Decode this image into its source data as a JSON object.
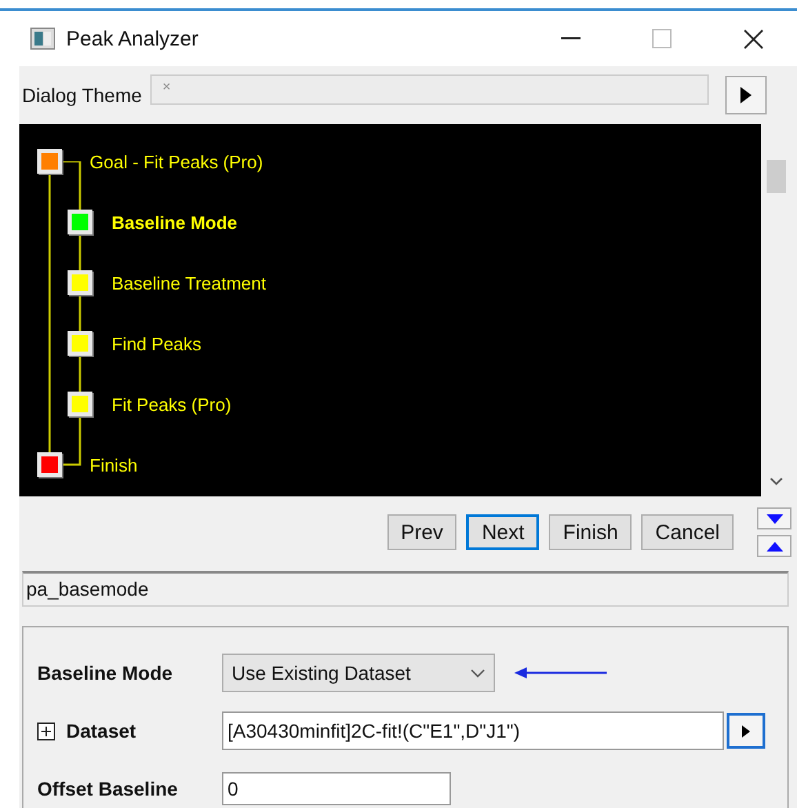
{
  "window": {
    "title": "Peak Analyzer"
  },
  "dialog_theme": {
    "label": "Dialog Theme",
    "value": "×"
  },
  "tree": [
    {
      "label": "Goal - Fit Peaks (Pro)",
      "color": "#ff7f00",
      "selected": false,
      "children": [
        {
          "label": "Baseline Mode",
          "color": "#00ff00",
          "selected": true
        },
        {
          "label": "Baseline Treatment",
          "color": "#ffff00",
          "selected": false
        },
        {
          "label": "Find Peaks",
          "color": "#ffff00",
          "selected": false
        },
        {
          "label": "Fit Peaks (Pro)",
          "color": "#ffff00",
          "selected": false
        }
      ]
    },
    {
      "label": "Finish",
      "color": "#ff0000",
      "selected": false
    }
  ],
  "buttons": [
    {
      "label": "Prev",
      "selected": false
    },
    {
      "label": "Next",
      "selected": true
    },
    {
      "label": "Finish",
      "selected": false
    },
    {
      "label": "Cancel",
      "selected": false
    }
  ],
  "page_name": "pa_basemode",
  "settings": [
    {
      "kind": "dropdown",
      "label": "Baseline Mode",
      "value": "Use Existing Dataset"
    },
    {
      "kind": "range",
      "label": "Dataset",
      "value": "[A30430minfit]2C-fit!(C\"E1\",D\"J1\")"
    },
    {
      "kind": "text",
      "label": "Offset Baseline",
      "value": "0"
    }
  ]
}
